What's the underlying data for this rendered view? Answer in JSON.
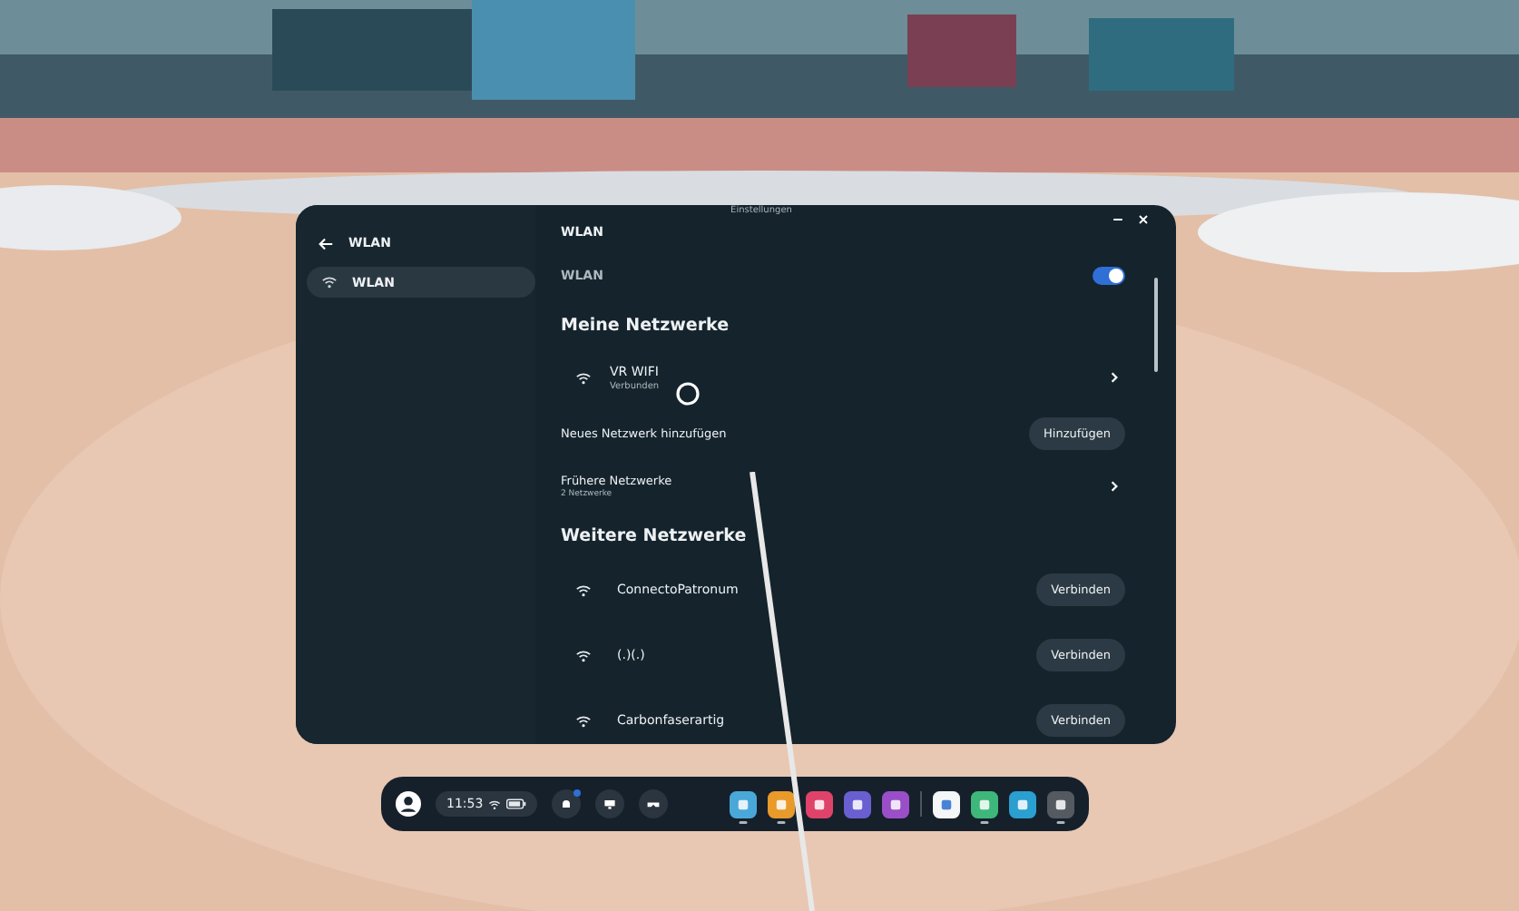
{
  "window": {
    "title": "Einstellungen"
  },
  "sidebar": {
    "back_label": "WLAN",
    "items": [
      {
        "label": "WLAN",
        "selected": true
      }
    ]
  },
  "content": {
    "heading": "WLAN",
    "wifi_toggle": {
      "label": "WLAN",
      "on": true
    },
    "my_networks": {
      "title": "Meine Netzwerke",
      "items": [
        {
          "name": "VR WIFI",
          "status": "Verbunden"
        }
      ]
    },
    "add_network": {
      "label": "Neues Netzwerk hinzufügen",
      "button": "Hinzufügen"
    },
    "previous_networks": {
      "label": "Frühere Netzwerke",
      "count": "2 Netzwerke"
    },
    "other_networks": {
      "title": "Weitere Netzwerke",
      "items": [
        {
          "name": "ConnectoPatronum",
          "button": "Verbinden"
        },
        {
          "name": "(.)(.)",
          "button": "Verbinden"
        },
        {
          "name": "Carbonfaserartig",
          "button": "Verbinden"
        }
      ]
    }
  },
  "taskbar": {
    "time": "11:53",
    "notification": true,
    "apps": [
      {
        "color": "#4aa8d8",
        "running": true
      },
      {
        "color": "#e89a2a",
        "running": true
      },
      {
        "color": "#e0436a",
        "running": false
      },
      {
        "color": "#6a5fd0",
        "running": false
      },
      {
        "color": "#9a4fc8",
        "running": false
      },
      {
        "color": "#f4f6f8",
        "running": false
      },
      {
        "color": "#3db87a",
        "running": true
      },
      {
        "color": "#2a9fd0",
        "running": false
      },
      {
        "color": "#555a60",
        "running": true
      }
    ]
  }
}
